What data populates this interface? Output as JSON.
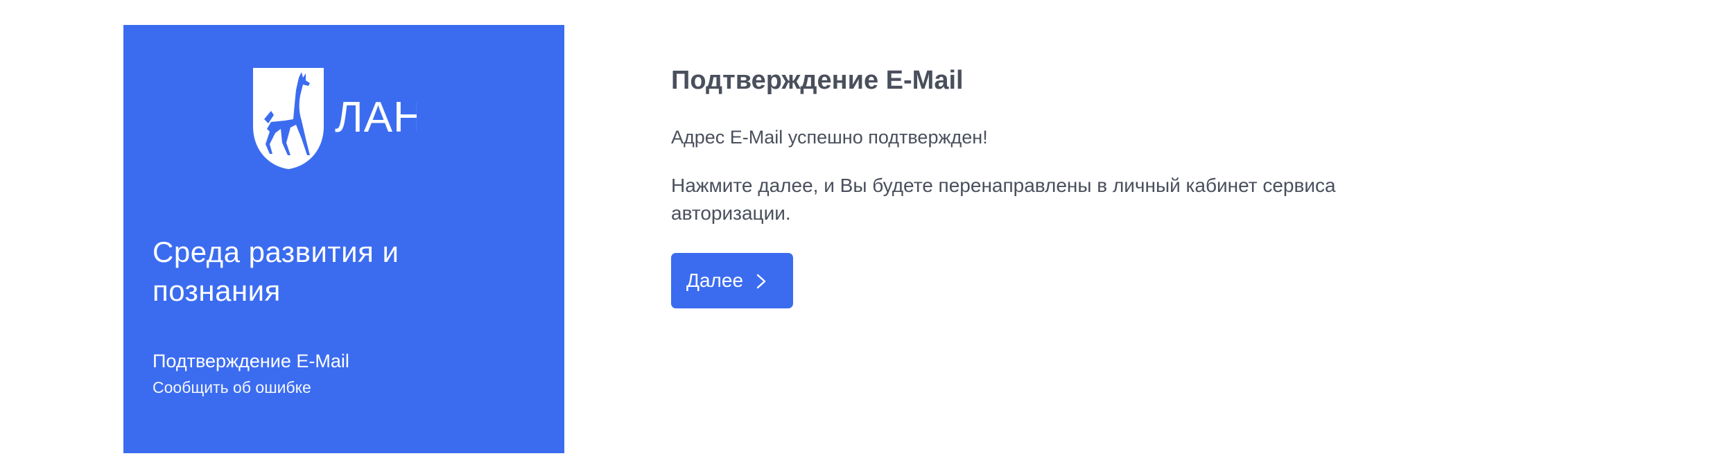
{
  "brand": {
    "logo_text": "ЛАНЬ",
    "tagline": "Среда развития и познания",
    "section_label": "Подтверждение E-Mail",
    "report_link": "Сообщить об ошибке"
  },
  "content": {
    "title": "Подтверждение E-Mail",
    "message": "Адрес E-Mail успешно подтвержден!",
    "instruction": "Нажмите далее, и Вы будете перенаправлены в личный кабинет сервиса авторизации."
  },
  "actions": {
    "next_label": "Далее"
  },
  "icons": {
    "logo": "deer-shield-logo-icon",
    "next": "chevron-right-icon"
  },
  "colors": {
    "accent": "#3b6cf0",
    "text": "#4a4f5c",
    "background": "#ffffff"
  }
}
